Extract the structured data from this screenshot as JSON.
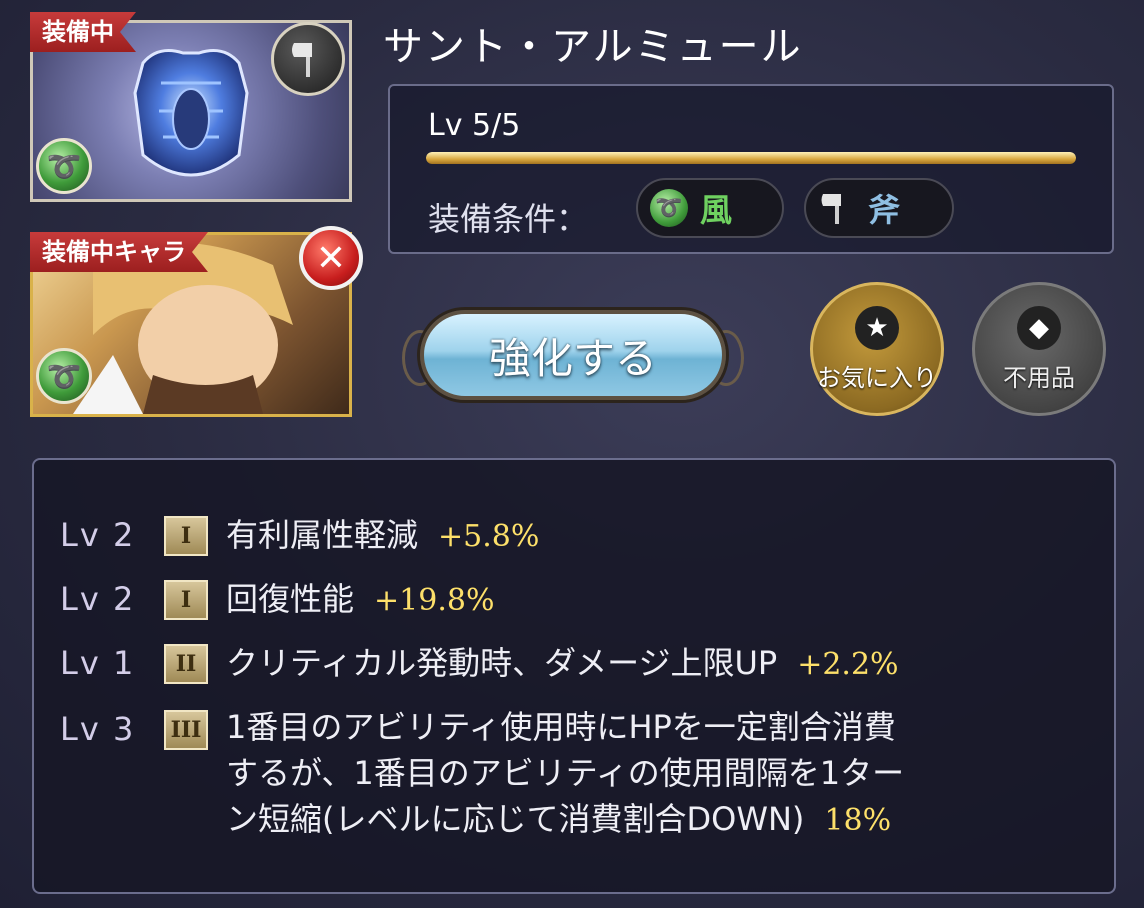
{
  "item": {
    "equipped_tag": "装備中",
    "name": "サント・アルミュール",
    "level_text": "Lv 5/5",
    "level_progress": 1.0,
    "requirements_label": "装備条件：",
    "requirement_element": "風",
    "requirement_weapon": "斧"
  },
  "character": {
    "equipped_tag": "装備中キャラ"
  },
  "actions": {
    "enhance_label": "強化する",
    "favorite_label": "お気に入り",
    "junk_label": "不用品"
  },
  "skills": [
    {
      "level": "Lv 2",
      "rank": "I",
      "text": "有利属性軽減",
      "value": "+5.8%"
    },
    {
      "level": "Lv 2",
      "rank": "I",
      "text": "回復性能",
      "value": "+19.8%"
    },
    {
      "level": "Lv 1",
      "rank": "II",
      "text": "クリティカル発動時、ダメージ上限UP",
      "value": "+2.2%"
    },
    {
      "level": "Lv 3",
      "rank": "III",
      "text_lines": [
        "1番目のアビリティ使用時にHPを一定割合消費",
        "するが、1番目のアビリティの使用間隔を1ター",
        "ン短縮(レベルに応じて消費割合DOWN)"
      ],
      "value": "18%"
    }
  ],
  "colors": {
    "background": "#2a2b41",
    "tag_red": "#c73b3b",
    "value_gold": "#fde06a",
    "wind_green": "#3f9b3a"
  },
  "icons": {
    "item_element": "wind-icon",
    "item_weapon": "axe-icon",
    "unequip": "close-icon",
    "favorite": "star-icon",
    "junk": "junk-icon"
  }
}
